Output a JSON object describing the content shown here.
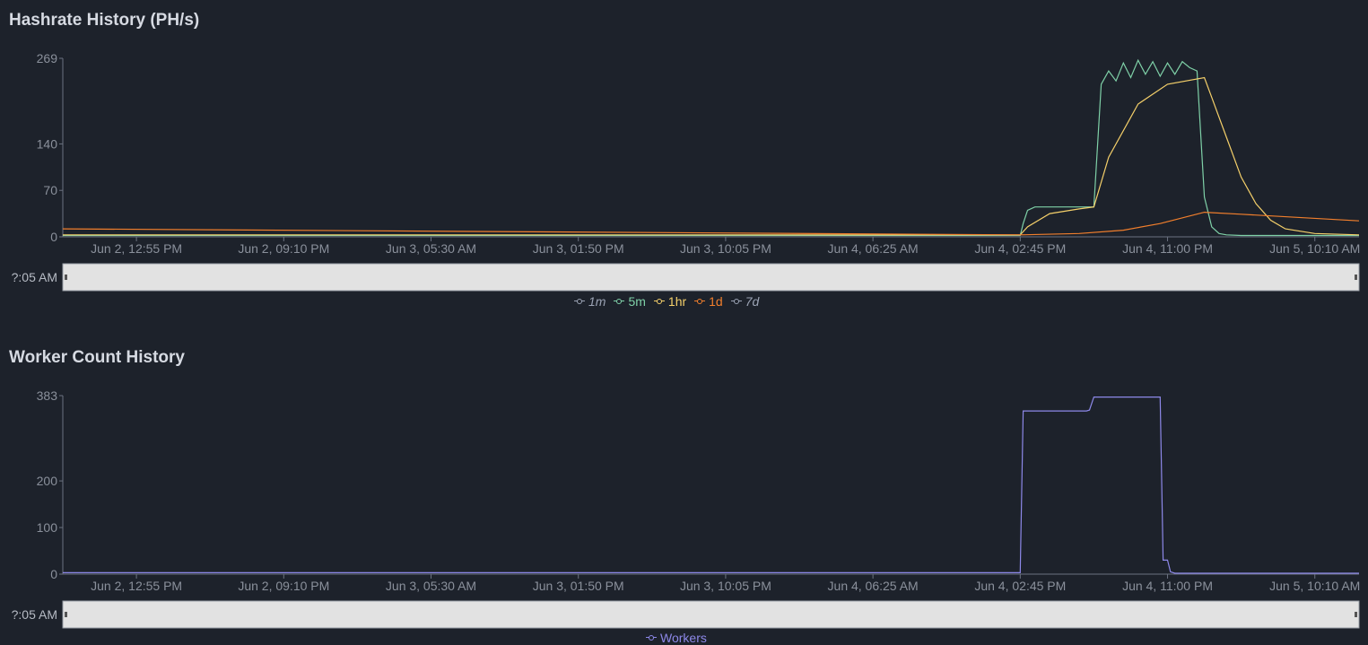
{
  "hashrate": {
    "title": "Hashrate History (PH/s)",
    "navigator_label": "?:05 AM",
    "chart_data": {
      "type": "line",
      "title": "Hashrate History (PH/s)",
      "ylim": [
        0,
        269
      ],
      "yticks": [
        0,
        70,
        140,
        269
      ],
      "x_tick_labels": [
        "Jun 2, 12:55 PM",
        "Jun 2, 09:10 PM",
        "Jun 3, 05:30 AM",
        "Jun 3, 01:50 PM",
        "Jun 3, 10:05 PM",
        "Jun 4, 06:25 AM",
        "Jun 4, 02:45 PM",
        "Jun 4, 11:00 PM",
        "Jun 5, 10:10 AM"
      ],
      "x_tick_positions": [
        0.5,
        1.5,
        2.5,
        3.5,
        4.5,
        5.5,
        6.5,
        7.5,
        8.5
      ],
      "xlim": [
        0,
        8.8
      ],
      "grid": false,
      "legend_position": "bottom",
      "series": [
        {
          "name": "1m",
          "color": "#9ba3b4",
          "italic": true,
          "visible": false,
          "x": [],
          "y": []
        },
        {
          "name": "5m",
          "color": "#7fd1a8",
          "italic": false,
          "visible": true,
          "x": [
            0,
            6.5,
            6.52,
            6.55,
            6.6,
            7.0,
            7.05,
            7.1,
            7.15,
            7.2,
            7.25,
            7.3,
            7.35,
            7.4,
            7.45,
            7.5,
            7.55,
            7.6,
            7.65,
            7.7,
            7.75,
            7.8,
            7.85,
            7.9,
            8.0,
            8.8
          ],
          "y": [
            2,
            2,
            20,
            40,
            45,
            45,
            230,
            250,
            235,
            262,
            240,
            266,
            245,
            264,
            242,
            262,
            245,
            264,
            255,
            250,
            60,
            15,
            5,
            3,
            2,
            2
          ]
        },
        {
          "name": "1hr",
          "color": "#f5d06a",
          "italic": false,
          "visible": true,
          "x": [
            0,
            6.5,
            6.55,
            6.7,
            6.9,
            7.0,
            7.1,
            7.3,
            7.5,
            7.75,
            7.8,
            7.9,
            8.0,
            8.1,
            8.2,
            8.3,
            8.5,
            8.8
          ],
          "y": [
            3,
            3,
            15,
            35,
            42,
            45,
            120,
            200,
            230,
            240,
            210,
            150,
            90,
            50,
            25,
            12,
            5,
            3
          ]
        },
        {
          "name": "1d",
          "color": "#f27f2c",
          "italic": false,
          "visible": true,
          "x": [
            0,
            6.5,
            6.9,
            7.2,
            7.45,
            7.75,
            8.0,
            8.8
          ],
          "y": [
            12,
            3,
            5,
            10,
            20,
            37,
            34,
            24
          ]
        },
        {
          "name": "7d",
          "color": "#9ba3b4",
          "italic": true,
          "visible": false,
          "x": [],
          "y": []
        }
      ]
    }
  },
  "workers": {
    "title": "Worker Count History",
    "navigator_label": "?:05 AM",
    "chart_data": {
      "type": "line",
      "title": "Worker Count History",
      "ylim": [
        0,
        383
      ],
      "yticks": [
        0,
        100,
        200,
        383
      ],
      "x_tick_labels": [
        "Jun 2, 12:55 PM",
        "Jun 2, 09:10 PM",
        "Jun 3, 05:30 AM",
        "Jun 3, 01:50 PM",
        "Jun 3, 10:05 PM",
        "Jun 4, 06:25 AM",
        "Jun 4, 02:45 PM",
        "Jun 4, 11:00 PM",
        "Jun 5, 10:10 AM"
      ],
      "x_tick_positions": [
        0.5,
        1.5,
        2.5,
        3.5,
        4.5,
        5.5,
        6.5,
        7.5,
        8.5
      ],
      "xlim": [
        0,
        8.8
      ],
      "grid": false,
      "legend_position": "bottom",
      "series": [
        {
          "name": "Workers",
          "color": "#8d88e8",
          "italic": false,
          "visible": true,
          "x": [
            0,
            6.5,
            6.52,
            6.95,
            6.97,
            7.0,
            7.3,
            7.32,
            7.45,
            7.47,
            7.5,
            7.52,
            7.55,
            8.8
          ],
          "y": [
            3,
            3,
            350,
            350,
            352,
            380,
            380,
            380,
            380,
            30,
            30,
            5,
            2,
            2
          ]
        }
      ]
    }
  }
}
